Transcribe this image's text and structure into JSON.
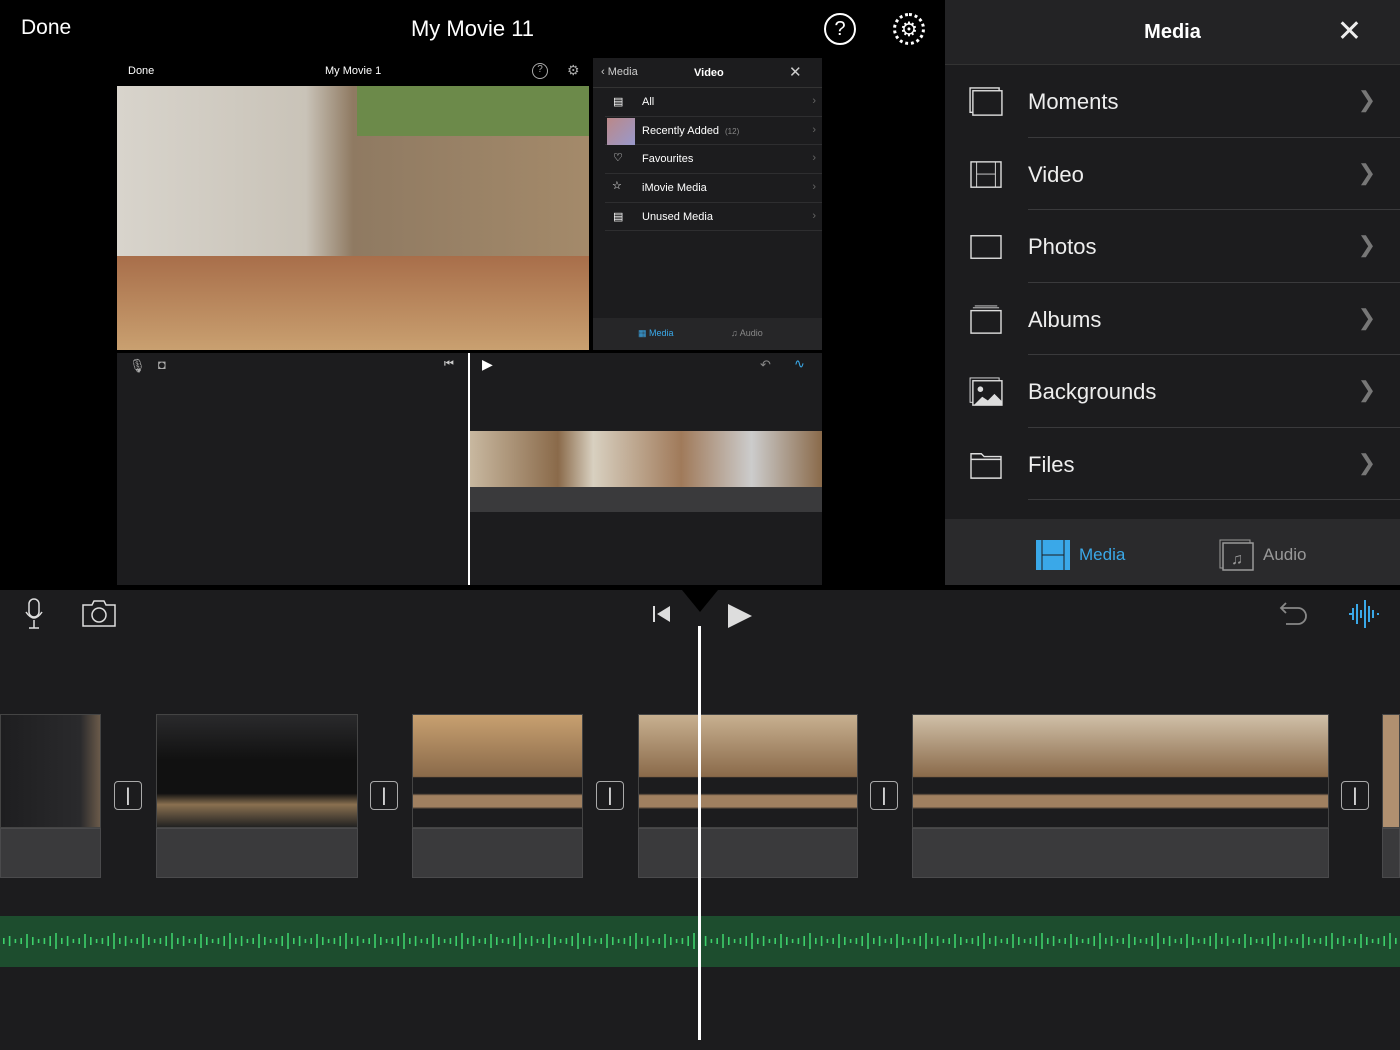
{
  "topbar": {
    "done_label": "Done",
    "title": "My Movie 11",
    "help_icon": "question-circle-icon",
    "settings_icon": "gear-icon"
  },
  "preview": {
    "mini_done": "Done",
    "mini_title": "My Movie 1",
    "mini_panel": {
      "back_label": "Media",
      "title": "Video",
      "items": [
        {
          "label": "All"
        },
        {
          "label": "Recently Added",
          "count": "(12)"
        },
        {
          "label": "Favourites"
        },
        {
          "label": "iMovie Media"
        },
        {
          "label": "Unused Media"
        }
      ],
      "tab_media": "Media",
      "tab_audio": "Audio"
    }
  },
  "media_panel": {
    "title": "Media",
    "items": [
      {
        "label": "Moments",
        "icon": "moments-icon"
      },
      {
        "label": "Video",
        "icon": "film-icon"
      },
      {
        "label": "Photos",
        "icon": "photo-frame-icon"
      },
      {
        "label": "Albums",
        "icon": "album-icon"
      },
      {
        "label": "Backgrounds",
        "icon": "image-icon"
      },
      {
        "label": "Files",
        "icon": "folder-icon"
      }
    ],
    "tabs": {
      "media": "Media",
      "audio": "Audio"
    },
    "accent": "#3aa8e8"
  },
  "timeline": {
    "audio_color": "#1d4d2e",
    "waveform_color": "#3ccf6a"
  }
}
